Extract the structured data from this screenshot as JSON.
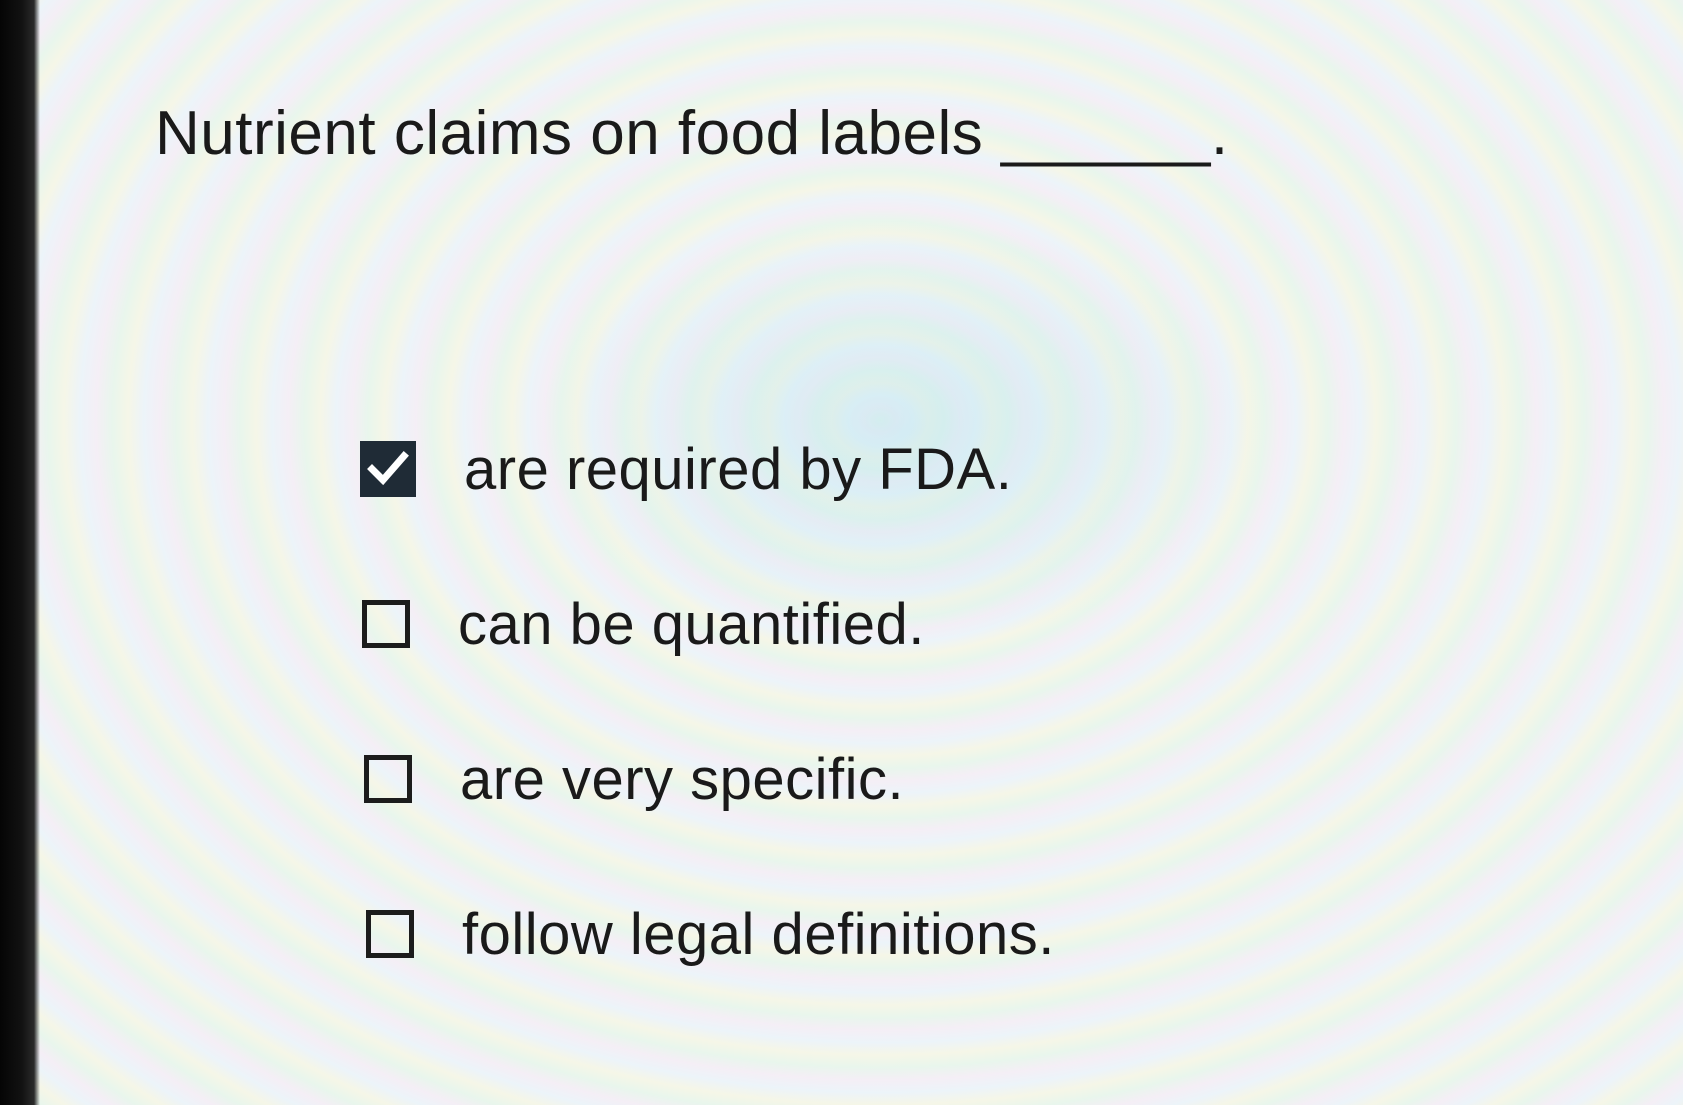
{
  "question": {
    "text": "Nutrient claims on food labels ______."
  },
  "options": [
    {
      "label": "are required by FDA.",
      "checked": true
    },
    {
      "label": "can be quantified.",
      "checked": false
    },
    {
      "label": "are very specific.",
      "checked": false
    },
    {
      "label": "follow legal definitions.",
      "checked": false
    }
  ],
  "colors": {
    "checkbox_fill": "#1f2b36",
    "text": "#1a1a1a"
  }
}
